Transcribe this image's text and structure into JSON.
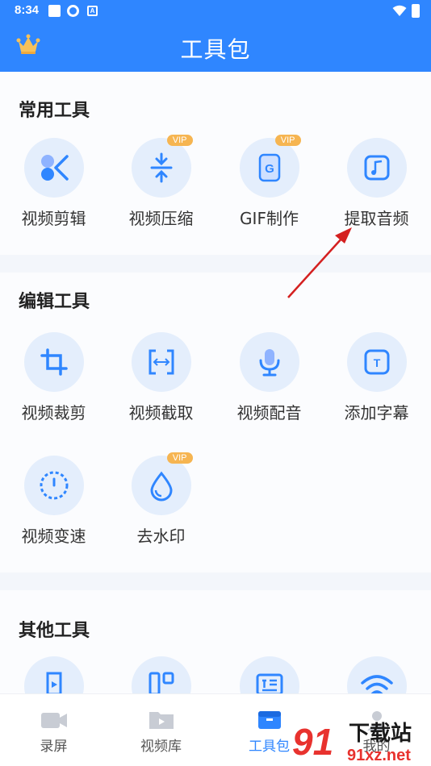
{
  "status_bar": {
    "time": "8:34",
    "notif_letter": "A"
  },
  "header": {
    "title": "工具包"
  },
  "sections": [
    {
      "title": "常用工具",
      "tools": [
        {
          "label": "视频剪辑",
          "icon": "scissors-icon",
          "vip": ""
        },
        {
          "label": "视频压缩",
          "icon": "compress-icon",
          "vip": "VIP"
        },
        {
          "label": "GIF制作",
          "icon": "gif-icon",
          "vip": "VIP"
        },
        {
          "label": "提取音频",
          "icon": "music-note-icon",
          "vip": ""
        }
      ]
    },
    {
      "title": "编辑工具",
      "tools": [
        {
          "label": "视频裁剪",
          "icon": "crop-icon",
          "vip": ""
        },
        {
          "label": "视频截取",
          "icon": "trim-icon",
          "vip": ""
        },
        {
          "label": "视频配音",
          "icon": "microphone-icon",
          "vip": ""
        },
        {
          "label": "添加字幕",
          "icon": "subtitle-icon",
          "vip": ""
        },
        {
          "label": "视频变速",
          "icon": "speed-icon",
          "vip": ""
        },
        {
          "label": "去水印",
          "icon": "water-drop-icon",
          "vip": "VIP"
        }
      ]
    },
    {
      "title": "其他工具",
      "tools": [
        {
          "label": "",
          "icon": "export-icon"
        },
        {
          "label": "",
          "icon": "split-icon"
        },
        {
          "label": "",
          "icon": "text-icon"
        },
        {
          "label": "",
          "icon": "wifi-transfer-icon"
        }
      ]
    }
  ],
  "bottom_nav": [
    {
      "label": "录屏",
      "icon": "record-icon",
      "active": false
    },
    {
      "label": "视频库",
      "icon": "video-library-icon",
      "active": false
    },
    {
      "label": "工具包",
      "icon": "toolbox-icon",
      "active": true
    },
    {
      "label": "我的",
      "icon": "profile-icon",
      "active": false
    }
  ],
  "watermark": {
    "text": "下载站",
    "url_text": "91xz.net"
  },
  "colors": {
    "primary": "#2f86ff",
    "vip": "#f6b551",
    "icon_bg": "#e4eefc",
    "annotation_arrow": "#d42020"
  }
}
